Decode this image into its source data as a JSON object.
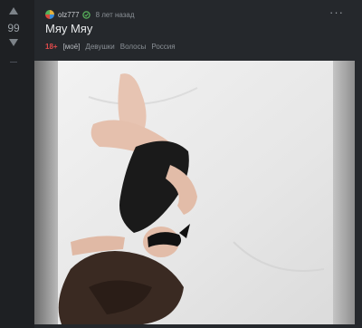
{
  "vote": {
    "rating": "99"
  },
  "story": {
    "author": "olz777",
    "time": "8 лет назад",
    "title": "Мяу Мяу",
    "more_label": "···",
    "tags": [
      {
        "label": "18+",
        "kind": "nsfw"
      },
      {
        "label": "[моё]",
        "kind": "mine"
      },
      {
        "label": "Девушки",
        "kind": "tag"
      },
      {
        "label": "Волосы",
        "kind": "tag"
      },
      {
        "label": "Россия",
        "kind": "tag"
      }
    ]
  },
  "icons": {
    "vote_up": "triangle-up-icon",
    "vote_down": "triangle-down-icon",
    "avatar": "user-avatar",
    "badge": "community-badge-icon",
    "more": "more-dots-icon"
  },
  "colors": {
    "background": "#1e2023",
    "card": "#25282c",
    "nsfw_tag": "#e14b4b",
    "text_muted": "#8a9096"
  }
}
